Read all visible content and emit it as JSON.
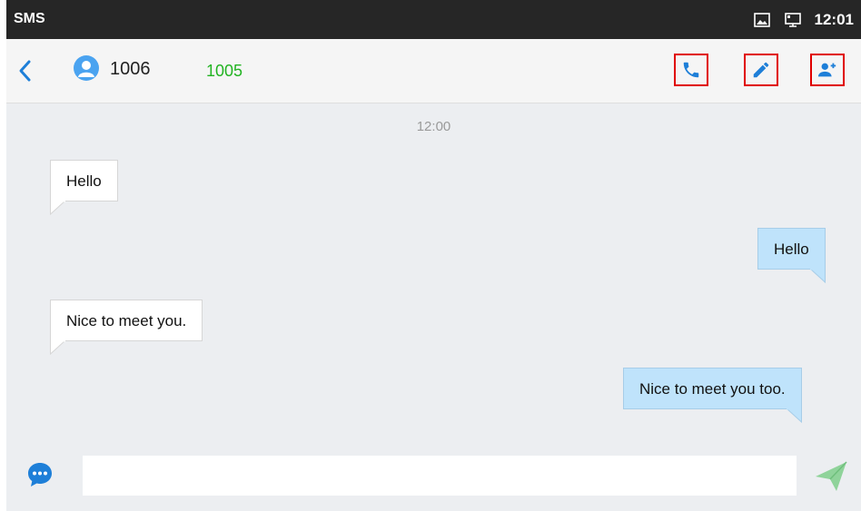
{
  "status_bar": {
    "app_label": "SMS",
    "time": "12:01",
    "icons": [
      "picture-icon",
      "desktop-icon"
    ]
  },
  "header": {
    "back_icon": "chevron-left-icon",
    "avatar_icon": "person-avatar-icon",
    "contact_name": "1006",
    "contact_number": "1005",
    "actions": [
      {
        "name": "call-button",
        "icon": "phone-icon"
      },
      {
        "name": "edit-button",
        "icon": "pencil-icon"
      },
      {
        "name": "add-contact-button",
        "icon": "person-add-icon"
      }
    ]
  },
  "conversation": {
    "timestamp": "12:00",
    "messages": [
      {
        "direction": "incoming",
        "text": "Hello"
      },
      {
        "direction": "outgoing",
        "text": "Hello"
      },
      {
        "direction": "incoming",
        "text": "Nice to meet you."
      },
      {
        "direction": "outgoing",
        "text": "Nice to meet you too."
      }
    ]
  },
  "composer": {
    "emoji_icon": "chat-bubble-icon",
    "input_value": "",
    "input_placeholder": "",
    "send_icon": "send-icon"
  },
  "colors": {
    "status_bar_bg": "#262626",
    "accent_blue": "#1e7fd8",
    "number_green": "#22b322",
    "outgoing_bubble": "#bfe3fb",
    "highlight_red": "#e00000",
    "send_green": "#8fd39a"
  }
}
